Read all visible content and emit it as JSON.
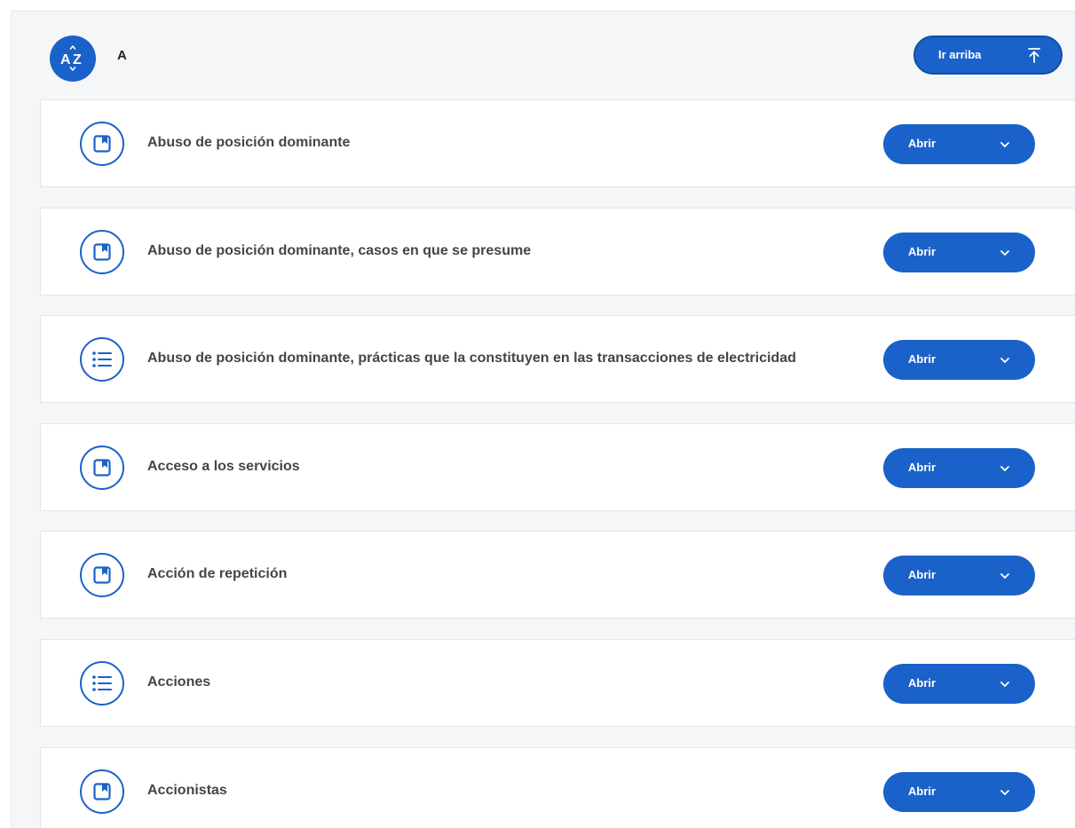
{
  "section": {
    "letter": "A",
    "az_icon": "sort-az-icon",
    "top_button": {
      "label": "Ir arriba",
      "icon": "arrow-up-to-top-icon"
    }
  },
  "colors": {
    "accent": "#1a62c9",
    "panel_bg": "#f5f6f8",
    "card_bg": "#ffffff"
  },
  "items": [
    {
      "title": "Abuso de posición dominante",
      "icon": "bookmark-icon",
      "button_label": "Abrir"
    },
    {
      "title": "Abuso de posición dominante, casos en que se presume",
      "icon": "bookmark-icon",
      "button_label": "Abrir"
    },
    {
      "title": "Abuso de posición dominante, prácticas que la constituyen en las transacciones de electricidad",
      "icon": "list-icon",
      "button_label": "Abrir"
    },
    {
      "title": "Acceso a los servicios",
      "icon": "bookmark-icon",
      "button_label": "Abrir"
    },
    {
      "title": "Acción de repetición",
      "icon": "bookmark-icon",
      "button_label": "Abrir"
    },
    {
      "title": "Acciones",
      "icon": "list-icon",
      "button_label": "Abrir"
    },
    {
      "title": "Accionistas",
      "icon": "bookmark-icon",
      "button_label": "Abrir"
    }
  ]
}
